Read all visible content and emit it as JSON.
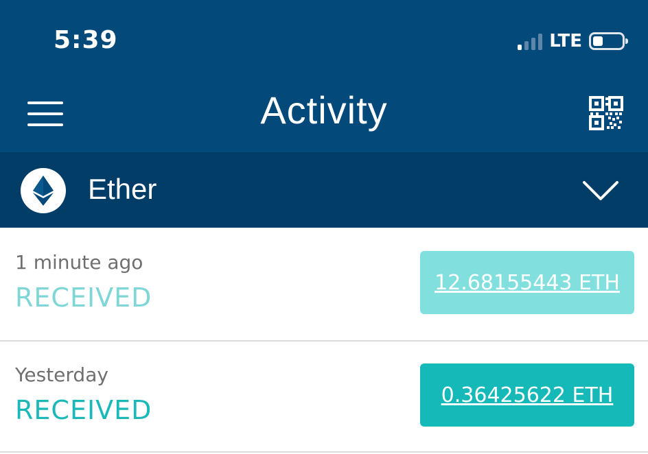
{
  "status_bar": {
    "time": "5:39",
    "network": "LTE"
  },
  "header": {
    "title": "Activity",
    "menu_icon": "hamburger-menu-icon",
    "qr_icon": "qr-code-icon",
    "background": "#03497a"
  },
  "currency_selector": {
    "name": "Ether",
    "icon": "ethereum-icon",
    "chevron": "chevron-down-icon",
    "background": "#023d68"
  },
  "transactions": [
    {
      "time": "1 minute ago",
      "status": "RECEIVED",
      "amount": "12.68155443 ETH",
      "status_color": "#7fd6d6",
      "amount_bg": "#81dfde"
    },
    {
      "time": "Yesterday",
      "status": "RECEIVED",
      "amount": "0.36425622 ETH",
      "status_color": "#1ab8b8",
      "amount_bg": "#15b9b8"
    }
  ]
}
